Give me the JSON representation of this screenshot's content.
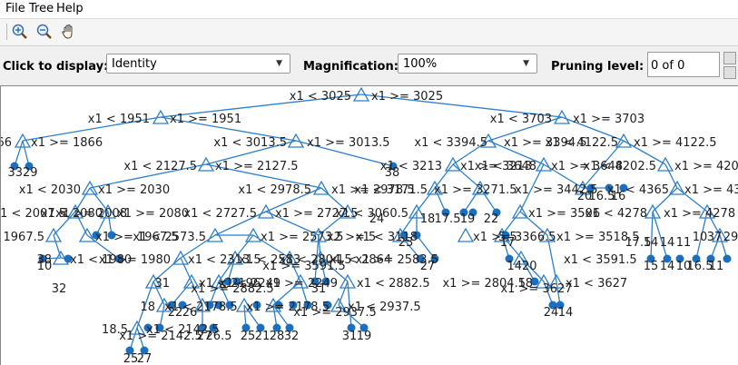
{
  "menubar": {
    "file": "File",
    "tree": "Tree",
    "help": "Help"
  },
  "toolbar": {
    "zoom_in_icon": "zoom-in-icon",
    "zoom_out_icon": "zoom-out-icon",
    "pan_icon": "hand-pan-icon"
  },
  "controls": {
    "display_label": "Click to display:",
    "display_value": "Identity",
    "magnification_label": "Magnification:",
    "magnification_value": "100%",
    "pruning_label": "Pruning level:",
    "pruning_value": "0 of 0"
  },
  "tree": {
    "colors": {
      "line": "#2f7fc9",
      "node": "#1a6fc0"
    },
    "labels": [
      "x1 < 3025",
      "x1 >= 3025",
      "x1 < 1951",
      "x1 >= 1951",
      "x1 < 3703",
      "x1 >= 3703",
      "66",
      "x1 >= 1866",
      "x1 < 3013.5",
      "x1 >= 3013.5",
      "x1 < 3394.5",
      "x1 >= 3394.5",
      "x1 < 4122.5",
      "x1 >= 4122.5",
      "3329",
      "38",
      "x1 < 2127.5",
      "x1 >= 2127.5",
      "x1 < 3213",
      "x1 >= 3213",
      "x1 < 3648",
      "x1 >= 3648",
      "x1 < 4202.5",
      "x1 >= 4202.5",
      "x1 < 2030",
      "x1 >= 2030",
      "x1 < 2978.5",
      "x1 >= 2978.5",
      "x1 < 3171.5",
      "x1 >= 3271.5",
      "x1 < 4365",
      "x1 >= 4365",
      "x1 >= 3442.5",
      "20",
      "16.5",
      "16",
      "x1 < 2007.5",
      "x1 >= 2008",
      "x1 < 2080",
      "x1 >= 2080",
      "x1 < 2727.5",
      "x1 >= 2727.5",
      "x1 < 3060.5",
      "24",
      "x1 >= 3506",
      "x1 < 4278",
      "x1 >= 4278",
      "17.5",
      "19",
      "22",
      "18",
      "1967.5",
      "x1 >= 1967.5",
      "x1 < 2573.5",
      "x1 >= 2573.5",
      "x2 >= 5",
      "x1 < 3118",
      "23",
      "x1 >= 3366.5",
      "17",
      "x1 >= 3518.5",
      "5.5",
      "17.5",
      "14",
      "14",
      "11",
      "10",
      "37",
      "29",
      "38",
      "x1 < 1980",
      "x1 >= 1980",
      "x1 < 2313.5",
      "x1 < 2583",
      "x1 >= 2583.5",
      "x1 < 2804.5",
      "x1 < 2864",
      "x1 >= 2804.5",
      "x1 < 3591.5",
      "x1 >= 3591.5",
      "27",
      "1420",
      "15",
      "14",
      "10",
      "16.5",
      "11",
      "10",
      "32",
      "31",
      "x1 < 2196",
      "x1 < 2249",
      "x1 >= 2249",
      "x1 < 2882.5",
      "x1 >= 2882.5",
      "31",
      "18",
      "x1 < 3627",
      "x1 >= 3627",
      "18",
      "x1 < 2178.5",
      "x1 >= 2178.5",
      "x1 < 2937.5",
      "x1 >= 2937.5",
      "22",
      "26",
      "24",
      "14",
      "18.5",
      "x1 < 2142.5",
      "x1 >= 2142.5",
      "27",
      "26.5",
      "25",
      "21",
      "28",
      "32",
      "31",
      "19",
      "25",
      "27",
      "28"
    ]
  }
}
